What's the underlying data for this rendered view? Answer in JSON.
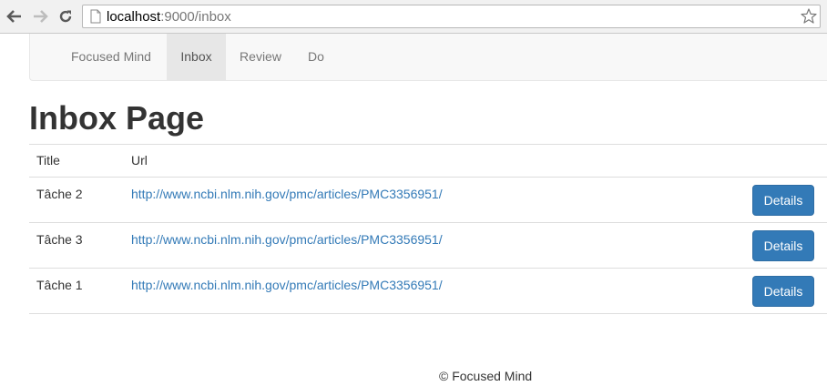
{
  "browser": {
    "url_host": "localhost",
    "url_rest": ":9000/inbox"
  },
  "navbar": {
    "brand": "Focused Mind",
    "items": [
      {
        "label": "Inbox",
        "active": true
      },
      {
        "label": "Review",
        "active": false
      },
      {
        "label": "Do",
        "active": false
      }
    ]
  },
  "page": {
    "title": "Inbox Page"
  },
  "table": {
    "headers": [
      "Title",
      "Url"
    ],
    "rows": [
      {
        "title": "Tâche 2",
        "url": "http://www.ncbi.nlm.nih.gov/pmc/articles/PMC3356951/",
        "action": "Details"
      },
      {
        "title": "Tâche 3",
        "url": "http://www.ncbi.nlm.nih.gov/pmc/articles/PMC3356951/",
        "action": "Details"
      },
      {
        "title": "Tâche 1",
        "url": "http://www.ncbi.nlm.nih.gov/pmc/articles/PMC3356951/",
        "action": "Details"
      }
    ]
  },
  "footer": {
    "text": "© Focused Mind"
  },
  "icons": {
    "back": "back-arrow-icon",
    "forward": "forward-arrow-icon",
    "reload": "reload-icon",
    "page": "page-icon",
    "bookmark": "star-icon"
  },
  "colors": {
    "primary": "#337ab7",
    "link": "#337ab7",
    "navbar_bg": "#f8f8f8",
    "nav_active_bg": "#e7e7e7"
  }
}
